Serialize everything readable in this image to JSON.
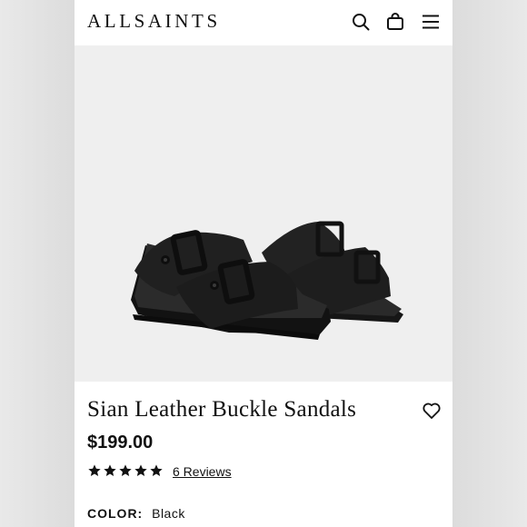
{
  "header": {
    "logo": "ALLSAINTS",
    "icons": [
      "search-icon",
      "shopping-bag-icon",
      "menu-icon"
    ]
  },
  "product": {
    "title": "Sian Leather Buckle Sandals",
    "price": "$199.00",
    "rating": 5,
    "rating_max": 5,
    "reviews_link": "6 Reviews",
    "color_label": "COLOR:",
    "color_value": "Black"
  },
  "colors": {
    "text": "#111111",
    "image_background": "#efefef",
    "sandal": "#1c1c1c"
  }
}
